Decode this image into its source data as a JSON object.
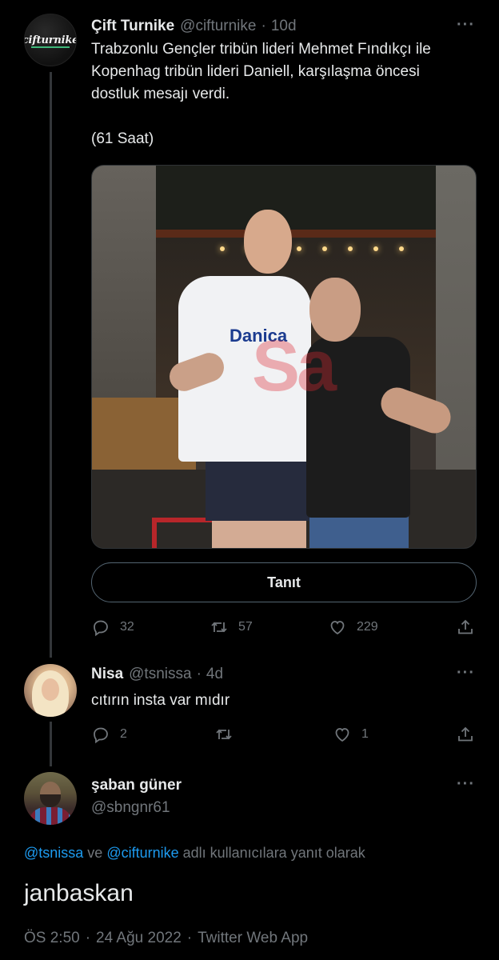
{
  "tweet1": {
    "avatar_text": "cifturnike",
    "name": "Çift Turnike",
    "handle": "@cifturnike",
    "time": "10d",
    "lines": [
      "Trabzonlu Gençler tribün lideri Mehmet Fındıkçı ile",
      "Kopenhag tribün lideri Daniell, karşılaşma öncesi",
      "dostluk mesajı verdi.",
      "(61 Saat)"
    ],
    "photo_shirt_text": "Danica",
    "photo_watermark": "Sa",
    "translate_button": "Tanıt",
    "replies": "32",
    "retweets": "57",
    "likes": "229"
  },
  "tweet2": {
    "name": "Nisa",
    "handle": "@tsnissa",
    "time": "4d",
    "text": "cıtırın insta var mıdır",
    "replies": "2",
    "likes": "1"
  },
  "tweet3": {
    "name": "şaban güner",
    "handle": "@sbngnr61",
    "reply_mention1": "@tsnissa",
    "reply_mid": " ve ",
    "reply_mention2": "@cifturnike",
    "reply_tail": " adlı kullanıcılara yanıt olarak",
    "text": "janbaskan",
    "time": "ÖS 2:50",
    "date": "24 Ağu 2022",
    "source": "Twitter Web App"
  },
  "icons": {
    "more": "more-icon",
    "reply": "reply-icon",
    "retweet": "retweet-icon",
    "like": "like-icon",
    "share": "share-icon"
  },
  "colors": {
    "background": "#000000",
    "text": "#e7e9ea",
    "muted": "#71767b",
    "mention": "#1d9bf0",
    "line": "#333639"
  }
}
